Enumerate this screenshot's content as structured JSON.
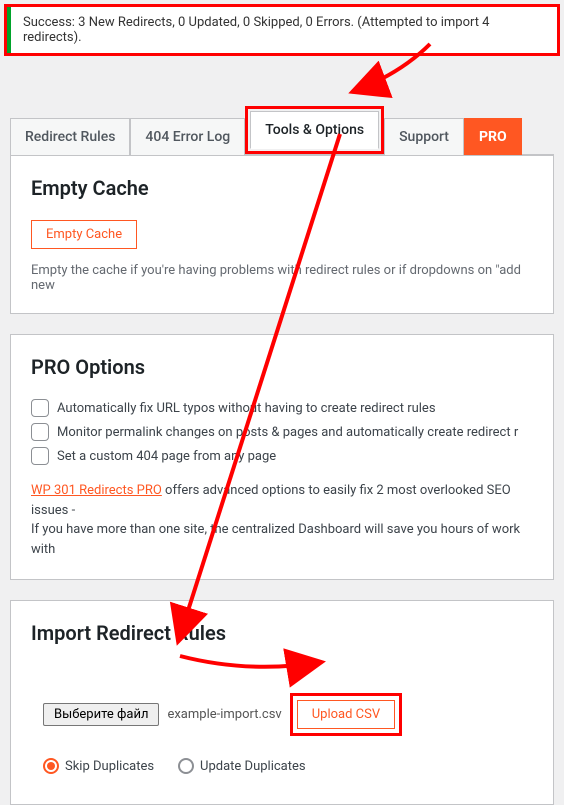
{
  "notice": {
    "text": "Success: 3 New Redirects, 0 Updated, 0 Skipped, 0 Errors. (Attempted to import 4 redirects)."
  },
  "tabs": {
    "rules": "Redirect Rules",
    "errorlog": "404 Error Log",
    "tools": "Tools & Options",
    "support": "Support",
    "pro": "PRO"
  },
  "empty_cache": {
    "heading": "Empty Cache",
    "button": "Empty Cache",
    "desc": "Empty the cache if you're having problems with redirect rules or if dropdowns on \"add new"
  },
  "pro_options": {
    "heading": "PRO Options",
    "opt1": "Automatically fix URL typos without having to create redirect rules",
    "opt2": "Monitor permalink changes on posts & pages and automatically create redirect r",
    "opt3": "Set a custom 404 page from any page",
    "link_text": "WP 301 Redirects PRO",
    "line1_rest": " offers advanced options to easily fix 2 most overlooked SEO issues -",
    "line2": "If you have more than one site, the centralized Dashboard will save you hours of work with"
  },
  "import": {
    "heading": "Import Redirect Rules",
    "file_button": "Выберите файл",
    "file_name": "example-import.csv",
    "upload_button": "Upload CSV",
    "radio_skip": "Skip Duplicates",
    "radio_update": "Update Duplicates"
  }
}
